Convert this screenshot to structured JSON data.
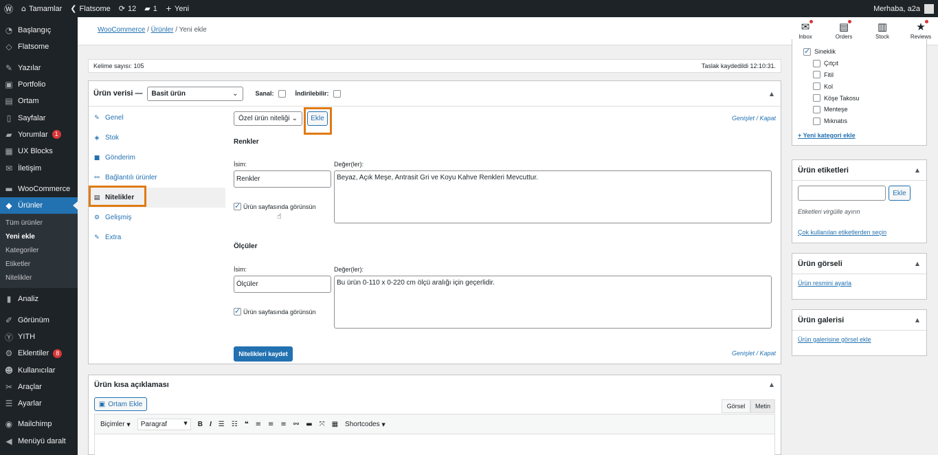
{
  "admin_bar": {
    "site_name": "Tamamlar",
    "theme": "Flatsome",
    "updates": "12",
    "comments": "1",
    "new": "Yeni",
    "greeting": "Merhaba, a2a"
  },
  "sidebar": {
    "items": [
      {
        "label": "Başlangıç",
        "icon": "dashboard-icon",
        "glyph": "◔"
      },
      {
        "label": "Flatsome",
        "icon": "flatsome-icon",
        "glyph": "◇"
      },
      {
        "label": "Yazılar",
        "icon": "pin-icon",
        "glyph": "✎"
      },
      {
        "label": "Portfolio",
        "icon": "portfolio-icon",
        "glyph": "▣"
      },
      {
        "label": "Ortam",
        "icon": "media-icon",
        "glyph": "▤"
      },
      {
        "label": "Sayfalar",
        "icon": "page-icon",
        "glyph": "▯"
      },
      {
        "label": "Yorumlar",
        "icon": "comment-icon",
        "glyph": "▰",
        "badge": "1"
      },
      {
        "label": "UX Blocks",
        "icon": "blocks-icon",
        "glyph": "▦"
      },
      {
        "label": "İletişim",
        "icon": "mail-icon",
        "glyph": "✉"
      },
      {
        "label": "WooCommerce",
        "icon": "woo-icon",
        "glyph": "▬"
      },
      {
        "label": "Ürünler",
        "icon": "product-icon",
        "glyph": "◆"
      }
    ],
    "submenu": [
      "Tüm ürünler",
      "Yeni ekle",
      "Kategoriler",
      "Etiketler",
      "Nitelikler"
    ],
    "items_after": [
      {
        "label": "Analiz",
        "icon": "chart-icon",
        "glyph": "▮"
      },
      {
        "label": "Görünüm",
        "icon": "brush-icon",
        "glyph": "✐"
      },
      {
        "label": "YITH",
        "icon": "yith-icon",
        "glyph": "Ⓨ"
      },
      {
        "label": "Eklentiler",
        "icon": "plugin-icon",
        "glyph": "⚙",
        "badge": "8"
      },
      {
        "label": "Kullanıcılar",
        "icon": "users-icon",
        "glyph": "☻"
      },
      {
        "label": "Araçlar",
        "icon": "tools-icon",
        "glyph": "✂"
      },
      {
        "label": "Ayarlar",
        "icon": "settings-icon",
        "glyph": "☰"
      },
      {
        "label": "Mailchimp",
        "icon": "mailchimp-icon",
        "glyph": "◉"
      },
      {
        "label": "Menüyü daralt",
        "icon": "collapse-icon",
        "glyph": "◀"
      }
    ]
  },
  "header": {
    "breadcrumb_1": "WooCommerce",
    "breadcrumb_sep": "/",
    "breadcrumb_2": "Ürünler",
    "breadcrumb_3": "Yeni ekle",
    "actions": [
      "Inbox",
      "Orders",
      "Stock",
      "Reviews"
    ]
  },
  "word_count": {
    "left": "Kelime sayısı: 105",
    "right": "Taslak kaydedildi 12:10:31."
  },
  "product_data": {
    "title": "Ürün verisi —",
    "product_type": "Basit ürün",
    "virtual_label": "Sanal:",
    "downloadable_label": "İndirilebilir:",
    "tabs": [
      {
        "label": "Genel",
        "icon": "wrench-icon",
        "glyph": "✎"
      },
      {
        "label": "Stok",
        "icon": "stock-icon",
        "glyph": "◈"
      },
      {
        "label": "Gönderim",
        "icon": "truck-icon",
        "glyph": "■"
      },
      {
        "label": "Bağlantılı ürünler",
        "icon": "link-icon",
        "glyph": "⚯"
      },
      {
        "label": "Nitelikler",
        "icon": "table-icon",
        "glyph": "▤"
      },
      {
        "label": "Gelişmiş",
        "icon": "gear-icon",
        "glyph": "⚙"
      },
      {
        "label": "Extra",
        "icon": "wrench-icon",
        "glyph": "✎"
      }
    ],
    "attribute_select": "Özel ürün niteliği",
    "add_button": "Ekle",
    "expand_collapse": "Genişlet / Kapat",
    "attributes": [
      {
        "title": "Renkler",
        "name_label": "İsim:",
        "name_value": "Renkler",
        "values_label": "Değer(ler):",
        "values": "Beyaz, Açık Meşe, Antrasit Gri ve Koyu Kahve Renkleri Mevcuttur.",
        "visible_label": "Ürün sayfasında görünsün"
      },
      {
        "title": "Ölçüler",
        "name_label": "İsim:",
        "name_value": "Ölçüler",
        "values_label": "Değer(ler):",
        "values": "Bu ürün 0-110 x 0-220 cm ölçü aralığı için geçerlidir.",
        "visible_label": "Ürün sayfasında görünsün"
      }
    ],
    "save_button": "Nitelikleri kaydet"
  },
  "short_description": {
    "title": "Ürün kısa açıklaması",
    "add_media": "Ortam Ekle",
    "tab_visual": "Görsel",
    "tab_text": "Metin",
    "formats": "Biçimler",
    "paragraph": "Paragraf",
    "shortcodes": "Shortcodes"
  },
  "categories": {
    "items": [
      {
        "label": "Sineklik",
        "checked": true,
        "child": false
      },
      {
        "label": "Çıtçıt",
        "checked": false,
        "child": true
      },
      {
        "label": "Fitil",
        "checked": false,
        "child": true
      },
      {
        "label": "Kol",
        "checked": false,
        "child": true
      },
      {
        "label": "Köşe Takosu",
        "checked": false,
        "child": true
      },
      {
        "label": "Menteşe",
        "checked": false,
        "child": true
      },
      {
        "label": "Mıknatıs",
        "checked": false,
        "child": true
      }
    ],
    "add_new": "+ Yeni kategori ekle"
  },
  "tags": {
    "title": "Ürün etiketleri",
    "add_button": "Ekle",
    "hint": "Etiketleri virgülle ayırın",
    "popular_link": "Çok kullanılan etiketlerden seçin"
  },
  "image": {
    "title": "Ürün görseli",
    "link": "Ürün resmini ayarla"
  },
  "gallery": {
    "title": "Ürün galerisi",
    "link": "Ürün galerisine görsel ekle"
  },
  "colors": {
    "accent": "#2271b1",
    "highlight": "#e07a12",
    "admin_dark": "#1d2327"
  }
}
